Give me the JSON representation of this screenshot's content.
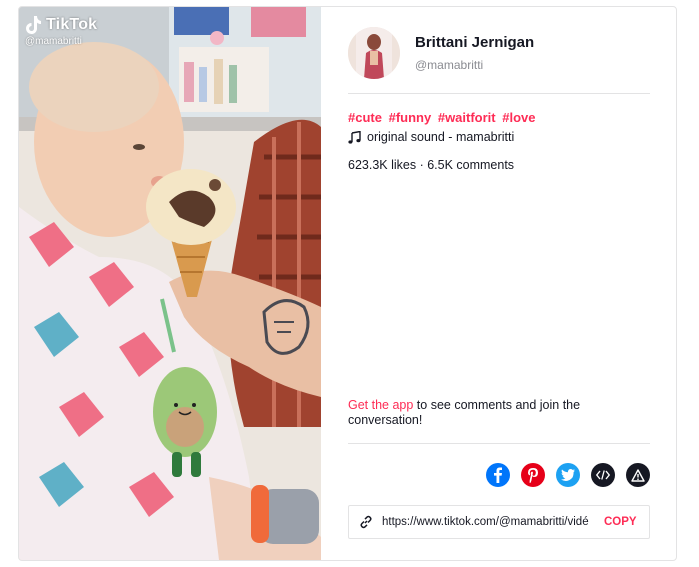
{
  "video": {
    "watermark_brand": "TikTok",
    "watermark_handle": "@mamabritti"
  },
  "author": {
    "display_name": "Brittani Jernigan",
    "handle": "@mamabritti"
  },
  "caption": {
    "hashtags": [
      "#cute",
      "#funny",
      "#waitforit",
      "#love"
    ]
  },
  "sound": {
    "icon": "music-note-icon",
    "label": "original sound - mamabritti"
  },
  "stats": {
    "text": "623.3K likes · 6.5K comments"
  },
  "cta": {
    "link_label": "Get the app",
    "rest": " to see comments and join the conversation!"
  },
  "share": {
    "items": [
      {
        "icon": "facebook-icon",
        "color": "#0075fa"
      },
      {
        "icon": "pinterest-icon",
        "color": "#e60019"
      },
      {
        "icon": "twitter-icon",
        "color": "#1da1f2"
      },
      {
        "icon": "embed-code-icon",
        "color": "#161823"
      },
      {
        "icon": "report-warning-icon",
        "color": "#161823"
      }
    ]
  },
  "link": {
    "url": "https://www.tiktok.com/@mamabritti/vidé",
    "copy_label": "COPY"
  },
  "colors": {
    "accent": "#fe2c55",
    "text_primary": "#161823",
    "text_secondary": "#8a8b91",
    "border": "#e3e3e4"
  }
}
